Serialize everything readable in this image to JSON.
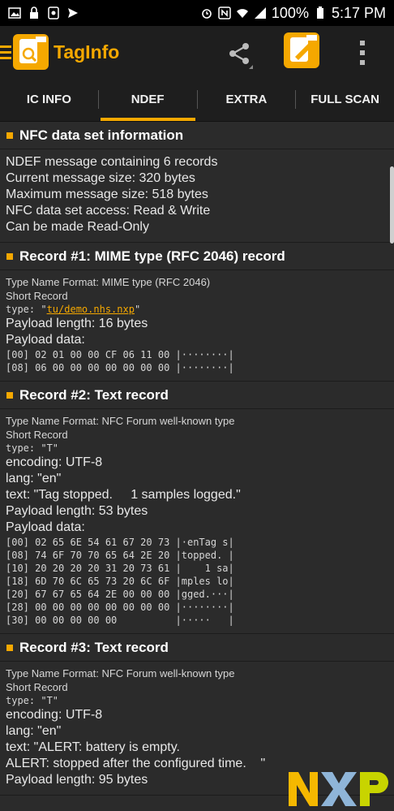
{
  "statusbar": {
    "battery": "100%",
    "time": "5:17 PM"
  },
  "app": {
    "title": "TagInfo"
  },
  "tabs": [
    {
      "label": "IC INFO"
    },
    {
      "label": "NDEF"
    },
    {
      "label": "EXTRA"
    },
    {
      "label": "FULL SCAN"
    }
  ],
  "sections": {
    "info": {
      "title": "NFC data set information",
      "lines": [
        "NDEF message containing 6 records",
        "Current message size: 320 bytes",
        "Maximum message size: 518 bytes",
        "NFC data set access: Read & Write",
        "Can be made Read-Only"
      ]
    },
    "record1": {
      "title": "Record #1: MIME type (RFC 2046) record",
      "tnf": "Type Name Format: MIME type (RFC 2046)",
      "short": "Short Record",
      "type_prefix": "type: \"",
      "type_link": "tu/demo.nhs.nxp",
      "type_suffix": "\"",
      "payload_length": "Payload length: 16 bytes",
      "payload_data": "Payload data:",
      "hex": [
        "[00] 02 01 00 00 CF 06 11 00 |········|",
        "[08] 06 00 00 00 00 00 00 00 |········|"
      ]
    },
    "record2": {
      "title": "Record #2: Text record",
      "tnf": "Type Name Format: NFC Forum well-known type",
      "short": "Short Record",
      "type": "type: \"T\"",
      "encoding": "encoding: UTF-8",
      "lang": "lang: \"en\"",
      "text": "text: \"Tag stopped.     1 samples logged.\"",
      "payload_length": "Payload length: 53 bytes",
      "payload_data": "Payload data:",
      "hex": [
        "[00] 02 65 6E 54 61 67 20 73 |·enTag s|",
        "[08] 74 6F 70 70 65 64 2E 20 |topped. |",
        "[10] 20 20 20 20 31 20 73 61 |    1 sa|",
        "[18] 6D 70 6C 65 73 20 6C 6F |mples lo|",
        "[20] 67 67 65 64 2E 00 00 00 |gged.···|",
        "[28] 00 00 00 00 00 00 00 00 |········|",
        "[30] 00 00 00 00 00          |·····   |"
      ]
    },
    "record3": {
      "title": "Record #3: Text record",
      "tnf": "Type Name Format: NFC Forum well-known type",
      "short": "Short Record",
      "type": "type: \"T\"",
      "encoding": "encoding: UTF-8",
      "lang": "lang: \"en\"",
      "text1": "text: \"ALERT: battery is empty.",
      "text2": "ALERT: stopped after the configured time.    \"",
      "payload_length": "Payload length: 95 bytes"
    }
  },
  "watermark": {
    "text": "NXP"
  },
  "colors": {
    "accent": "#f5a800",
    "background": "#2b2b2b",
    "bar": "#1e1e1e"
  }
}
